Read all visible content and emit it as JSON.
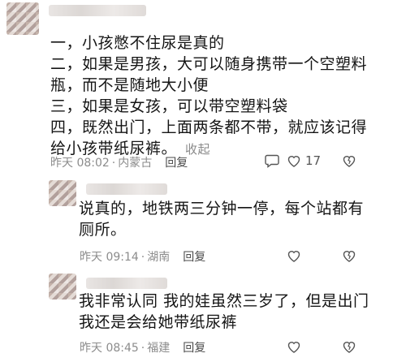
{
  "comments": [
    {
      "lines": [
        "一，小孩憋不住尿是真的",
        "二，如果是男孩，大可以随身携带一个空塑料",
        "瓶，而不是随地大小便",
        "三，如果是女孩，可以带空塑料袋",
        "四，既然出门，上面两条都不带，就应该记得",
        "给小孩带纸尿裤。"
      ],
      "fold_label": "收起",
      "time": "昨天 08:02",
      "location": "内蒙古",
      "reply_label": "回复",
      "like_count": "17"
    },
    {
      "lines": [
        "说真的，地铁两三分钟一停，每个站都有",
        "厕所。"
      ],
      "time": "昨天 09:14",
      "location": "湖南",
      "reply_label": "回复"
    },
    {
      "lines": [
        "我非常认同 我的娃虽然三岁了，但是出门",
        "我还是会给她带纸尿裤"
      ],
      "time": "昨天 08:45",
      "location": "福建",
      "reply_label": "回复"
    }
  ]
}
